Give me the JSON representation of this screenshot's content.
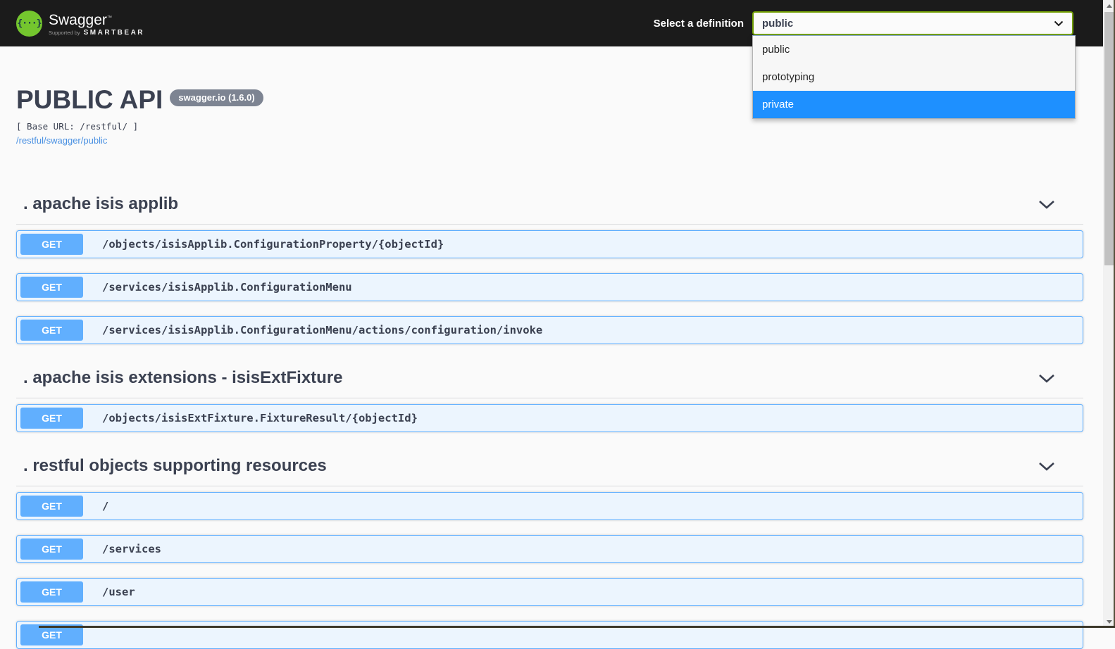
{
  "colors": {
    "topbar_bg": "#1b1b1b",
    "logo_green": "#74c62e",
    "select_border_green": "#74a106",
    "dropdown_highlight_blue": "#1e90ff",
    "method_get_blue": "#61affe",
    "endpoint_row_bg": "#ecf5fe",
    "heading_gray": "#3b4151",
    "link_blue": "#4990e2",
    "badge_gray": "#7d8492"
  },
  "topbar": {
    "logo_glyph": "{···}",
    "brand": "Swagger",
    "brand_trademark": "TM",
    "supported_by_prefix": "Supported by",
    "supported_by_brand": "SMARTBEAR",
    "select_label": "Select a definition",
    "select": {
      "value": "public",
      "options": [
        {
          "label": "public",
          "highlighted": false
        },
        {
          "label": "prototyping",
          "highlighted": false
        },
        {
          "label": "private",
          "highlighted": true
        }
      ]
    }
  },
  "api_info": {
    "title": "PUBLIC API",
    "version_badge": "swagger.io (1.6.0)",
    "base_url_text": "[ Base URL: /restful/ ]",
    "spec_link": "/restful/swagger/public"
  },
  "sections": [
    {
      "title": ". apache isis applib",
      "endpoints": [
        {
          "method": "GET",
          "path": "/objects/isisApplib.ConfigurationProperty/{objectId}",
          "partial": false
        },
        {
          "method": "GET",
          "path": "/services/isisApplib.ConfigurationMenu",
          "partial": false
        },
        {
          "method": "GET",
          "path": "/services/isisApplib.ConfigurationMenu/actions/configuration/invoke",
          "partial": false
        }
      ]
    },
    {
      "title": ". apache isis extensions - isisExtFixture",
      "endpoints": [
        {
          "method": "GET",
          "path": "/objects/isisExtFixture.FixtureResult/{objectId}",
          "partial": false
        }
      ]
    },
    {
      "title": ". restful objects supporting resources",
      "endpoints": [
        {
          "method": "GET",
          "path": "/",
          "partial": false
        },
        {
          "method": "GET",
          "path": "/services",
          "partial": false
        },
        {
          "method": "GET",
          "path": "/user",
          "partial": false
        },
        {
          "method": "GET",
          "path": "",
          "partial": true
        }
      ]
    }
  ],
  "scrollbar": {
    "thumb_visible": true
  }
}
